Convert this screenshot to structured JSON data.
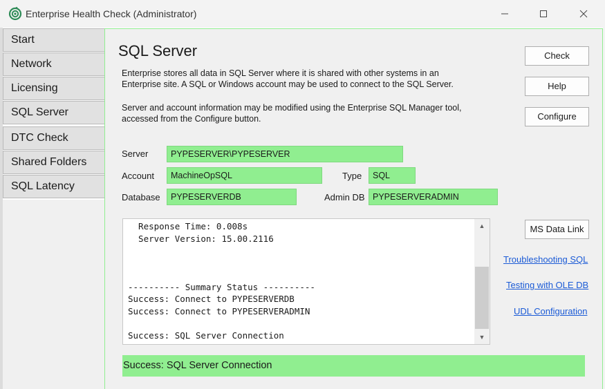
{
  "window": {
    "title": "Enterprise Health Check (Administrator)",
    "accent_color": "#90ee90"
  },
  "sidebar": {
    "items": [
      {
        "label": "Start",
        "active": false
      },
      {
        "label": "Network",
        "active": false
      },
      {
        "label": "Licensing",
        "active": false
      },
      {
        "label": "SQL Server",
        "active": true
      },
      {
        "label": "DTC Check",
        "active": false
      },
      {
        "label": "Shared Folders",
        "active": false
      },
      {
        "label": "SQL Latency",
        "active": false
      }
    ]
  },
  "main": {
    "heading": "SQL Server",
    "desc1_line1": "Enterprise stores all data in SQL Server where it is shared with other systems in an",
    "desc1_line2": "Enterprise site. A SQL or Windows account may be used to connect to the SQL Server.",
    "desc2_line1": "Server and account information may be modified using the Enterprise SQL Manager tool,",
    "desc2_line2": "accessed from the Configure button.",
    "buttons": {
      "check": "Check",
      "help": "Help",
      "configure": "Configure",
      "ms_data_link": "MS Data Link"
    },
    "fields": {
      "server_label": "Server",
      "server_value": "PYPESERVER\\PYPESERVER",
      "account_label": "Account",
      "account_value": "MachineOpSQL",
      "type_label": "Type",
      "type_value": "SQL",
      "database_label": "Database",
      "database_value": "PYPESERVERDB",
      "admin_db_label": "Admin DB",
      "admin_db_value": "PYPESERVERADMIN"
    },
    "log_lines": [
      "  Response Time: 0.008s",
      "  Server Version: 15.00.2116",
      "",
      "",
      "",
      "---------- Summary Status ----------",
      "Success: Connect to PYPESERVERDB",
      "Success: Connect to PYPESERVERADMIN",
      "",
      "Success: SQL Server Connection"
    ],
    "links": {
      "troubleshooting": "Troubleshooting SQL",
      "testing": "Testing with OLE DB",
      "udl": "UDL Configuration"
    },
    "status": "Success: SQL Server Connection"
  }
}
